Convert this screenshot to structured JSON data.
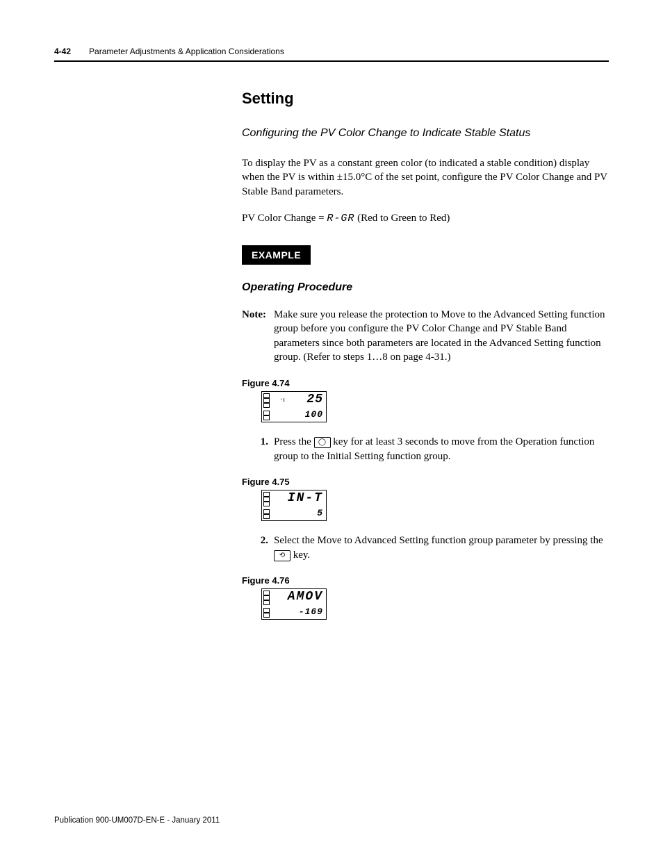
{
  "header": {
    "page_number": "4-42",
    "chapter_title": "Parameter Adjustments & Application Considerations"
  },
  "section": {
    "heading": "Setting",
    "subheading": "Configuring the PV Color Change to Indicate Stable Status",
    "para1": "To display the PV as a constant green color (to indicated a stable condition) display when the PV is within ±15.0°C of the set point, configure the PV Color Change and PV Stable Band parameters.",
    "para2_prefix": "PV Color Change = ",
    "para2_code": "R-GR",
    "para2_suffix": " (Red to Green to Red)"
  },
  "example_label": "EXAMPLE",
  "operating_procedure": {
    "heading": "Operating Procedure",
    "note_label": "Note:",
    "note_body": "Make sure you release the protection to Move to the Advanced Setting function group before you configure the PV Color Change and PV Stable Band parameters since both parameters are located in the Advanced Setting function group. (Refer to steps 1…8 on page 4-31.)"
  },
  "figures": {
    "f74": {
      "caption": "Figure 4.74",
      "top_unit": "°C",
      "top_value": "25",
      "bottom_value": "100"
    },
    "f75": {
      "caption": "Figure 4.75",
      "top_value": "IN-T",
      "bottom_value": "5"
    },
    "f76": {
      "caption": "Figure 4.76",
      "top_value": "AMOV",
      "bottom_value": "-169"
    }
  },
  "steps": {
    "s1_num": "1.",
    "s1_a": "Press the ",
    "s1_key": "◯",
    "s1_b": " key for at least 3 seconds to move from the Operation function group to the Initial Setting function group.",
    "s2_num": "2.",
    "s2_a": "Select the Move to Advanced Setting function group parameter by pressing the ",
    "s2_key": "⟲",
    "s2_b": " key."
  },
  "footer": "Publication 900-UM007D-EN-E - January 2011"
}
